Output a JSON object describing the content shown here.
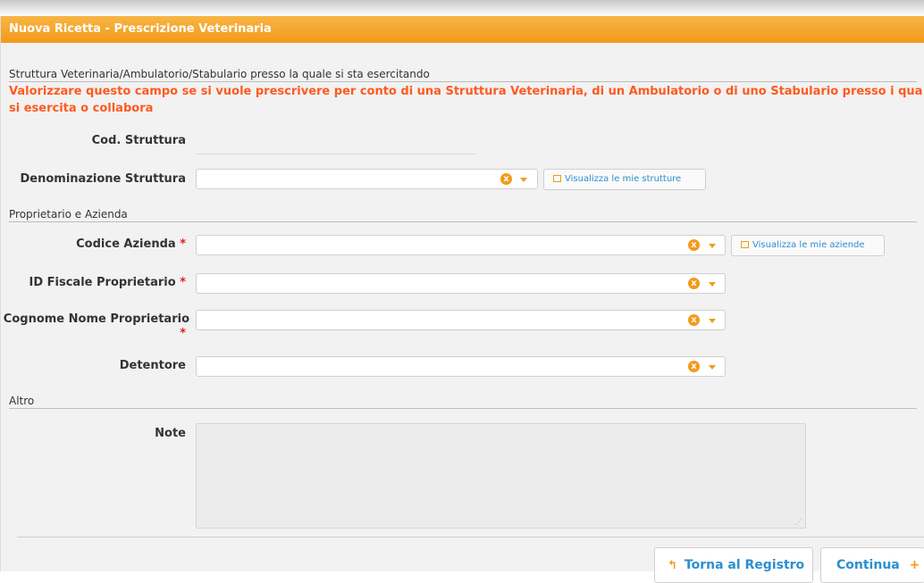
{
  "window": {
    "title": "Nuova Ricetta - Prescrizione Veterinaria"
  },
  "sections": {
    "struttura": "Struttura Veterinaria/Ambulatorio/Stabulario presso la quale si sta esercitando",
    "proprietario": "Proprietario e Azienda",
    "altro": "Altro"
  },
  "warning": {
    "line1": "Valorizzare questo campo se si vuole prescrivere per conto di una Struttura Veterinaria, di un Ambulatorio o di uno Stabulario presso i qua",
    "line2": "si esercita o collabora"
  },
  "fields": {
    "cod_struttura": {
      "label": "Cod. Struttura",
      "value": ""
    },
    "denominazione": {
      "label": "Denominazione Struttura",
      "value": "",
      "link": "Visualizza le mie strutture"
    },
    "codice_azienda": {
      "label": "Codice Azienda",
      "required": "*",
      "value": "",
      "link": "Visualizza le mie aziende"
    },
    "id_fiscale": {
      "label": "ID Fiscale Proprietario",
      "required": "*",
      "value": ""
    },
    "cognome_nome": {
      "label": "Cognome Nome Proprietario",
      "required": "*",
      "value": ""
    },
    "detentore": {
      "label": "Detentore",
      "value": ""
    },
    "note": {
      "label": "Note",
      "value": ""
    }
  },
  "icons": {
    "clear": "x",
    "resize": "⋰"
  },
  "buttons": {
    "torna": {
      "icon": "↰",
      "label": "Torna al Registro"
    },
    "continua": {
      "label": "Continua",
      "icon": "+"
    }
  },
  "colors": {
    "accent": "#f29a1a",
    "warning": "#ff5a1f",
    "link": "#2b8fd0",
    "required": "#e02020"
  }
}
